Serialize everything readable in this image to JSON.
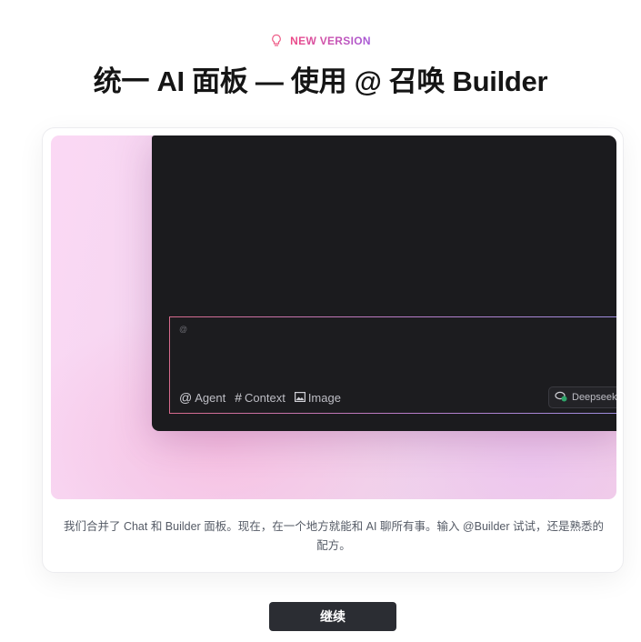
{
  "header": {
    "badge_icon": "lightbulb-icon",
    "badge_text": "NEW VERSION",
    "title": "统一 AI 面板 — 使用 @ 召唤 Builder"
  },
  "preview": {
    "input_hint": "@",
    "tools": [
      {
        "icon": "at-icon",
        "glyph": "@",
        "label": "Agent"
      },
      {
        "icon": "hash-icon",
        "glyph": "#",
        "label": "Context"
      },
      {
        "icon": "image-icon",
        "glyph": "",
        "label": "Image"
      }
    ],
    "model_icon": "deepseek-icon",
    "model_label": "Deepseek"
  },
  "description": "我们合并了 Chat 和 Builder 面板。现在，在一个地方就能和 AI 聊所有事。输入 @Builder 试试，还是熟悉的配方。",
  "actions": {
    "continue_label": "继续"
  },
  "colors": {
    "badge_gradient_start": "#ee4a86",
    "badge_gradient_end": "#a65ad8",
    "panel_bg": "#1b1b1e",
    "button_bg": "#2b2d33"
  }
}
